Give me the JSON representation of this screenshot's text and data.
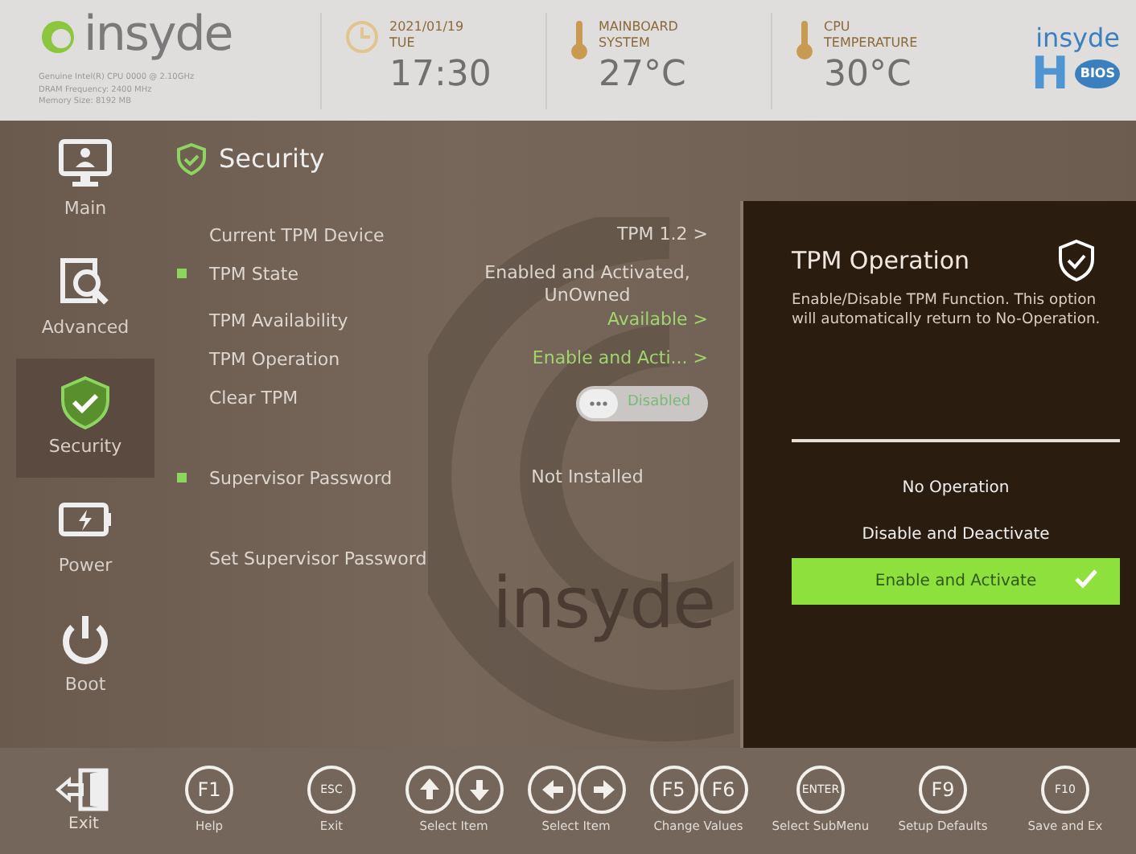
{
  "header": {
    "brand": "insyde",
    "system_info": [
      "Genuine Intel(R) CPU 0000 @ 2.10GHz",
      "DRAM Frequency: 2400 MHz",
      "Memory Size: 8192 MB"
    ],
    "widgets": [
      {
        "kind": "clock",
        "lines": [
          "2021/01/19",
          "TUE"
        ],
        "value": "17:30"
      },
      {
        "kind": "thermo",
        "lines": [
          "MAINBOARD",
          "SYSTEM"
        ],
        "value": "27°C"
      },
      {
        "kind": "thermo",
        "lines": [
          "CPU",
          "TEMPERATURE"
        ],
        "value": "30°C"
      }
    ],
    "product_logo": {
      "top": "insyde",
      "letter": "H",
      "badge": "BIOS"
    }
  },
  "sidebar": {
    "items": [
      {
        "label": "Main",
        "kind": "monitor",
        "selected": false
      },
      {
        "label": "Advanced",
        "kind": "magnifier",
        "selected": false
      },
      {
        "label": "Security",
        "kind": "shield",
        "selected": true
      },
      {
        "label": "Power",
        "kind": "battery",
        "selected": false
      },
      {
        "label": "Boot",
        "kind": "power",
        "selected": false
      }
    ]
  },
  "page": {
    "title": "Security",
    "background_logo": "insyde",
    "groups": [
      [
        {
          "label": "Current TPM Device",
          "value": "TPM 1.2 >",
          "marked": false,
          "highlight": false,
          "kind": "value"
        },
        {
          "label": "TPM State",
          "value": "Enabled and Activated, UnOwned",
          "marked": true,
          "highlight": false,
          "kind": "value"
        },
        {
          "label": "TPM Availability",
          "value": "Available >",
          "marked": false,
          "highlight": true,
          "kind": "value"
        },
        {
          "label": "TPM Operation",
          "value": "Enable and Acti...  >",
          "marked": false,
          "highlight": true,
          "kind": "value"
        },
        {
          "label": "Clear TPM",
          "value": "Disabled",
          "marked": false,
          "kind": "toggle",
          "on": false
        }
      ],
      [
        {
          "label": "Supervisor Password",
          "value": "Not Installed",
          "marked": true,
          "highlight": false,
          "kind": "value"
        }
      ],
      [
        {
          "label": "Set Supervisor Password",
          "marked": false,
          "kind": "action"
        }
      ]
    ]
  },
  "help_panel": {
    "title": "TPM Operation",
    "description": "Enable/Disable TPM Function. This option will automatically return to No-Operation.",
    "options": [
      {
        "label": "No Operation",
        "selected": false
      },
      {
        "label": "Disable and Deactivate",
        "selected": false
      },
      {
        "label": "Enable and Activate",
        "selected": true
      }
    ]
  },
  "footer": {
    "exit_label": "Exit",
    "keys": [
      {
        "keys": [
          {
            "kind": "text",
            "text": "F1"
          }
        ],
        "label": "Help"
      },
      {
        "keys": [
          {
            "kind": "text",
            "text": "ESC"
          }
        ],
        "label": "Exit"
      },
      {
        "keys": [
          {
            "kind": "up"
          },
          {
            "kind": "down"
          }
        ],
        "label": "Select Item"
      },
      {
        "keys": [
          {
            "kind": "left"
          },
          {
            "kind": "right"
          }
        ],
        "label": "Select Item"
      },
      {
        "keys": [
          {
            "kind": "text",
            "text": "F5"
          },
          {
            "kind": "text",
            "text": "F6"
          }
        ],
        "label": "Change Values"
      },
      {
        "keys": [
          {
            "kind": "text",
            "text": "ENTER"
          }
        ],
        "label": "Select SubMenu"
      },
      {
        "keys": [
          {
            "kind": "text",
            "text": "F9"
          }
        ],
        "label": "Setup Defaults"
      },
      {
        "keys": [
          {
            "kind": "text",
            "text": "F10"
          }
        ],
        "label": "Save and Ex"
      }
    ]
  }
}
